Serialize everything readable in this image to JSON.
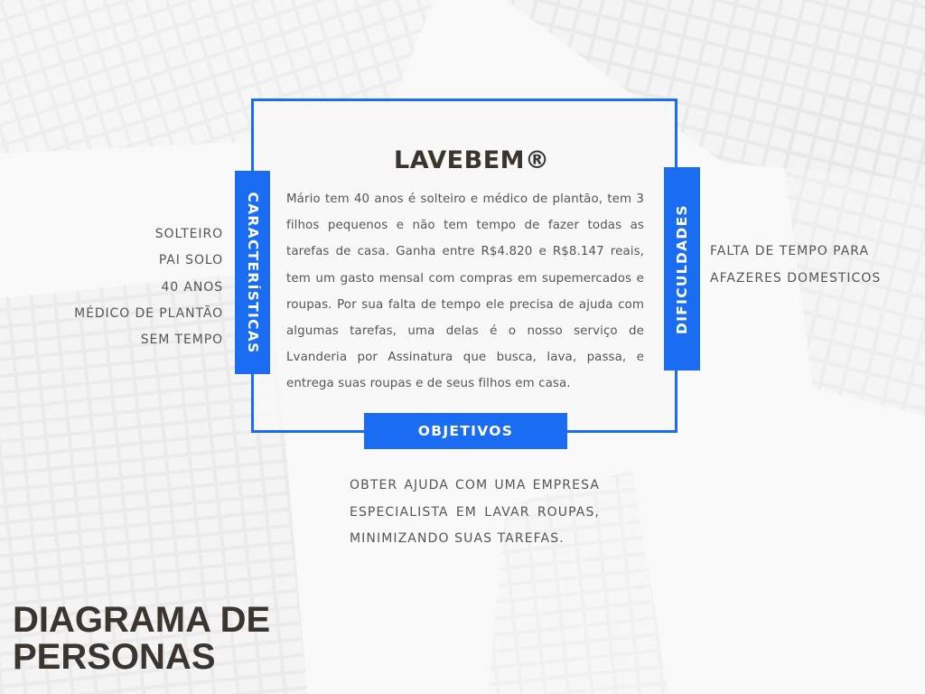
{
  "title": "LAVEBEM®",
  "description": "Mário tem 40 anos é solteiro e médico de plantão, tem 3 filhos pequenos e não tem tempo de fazer todas as tarefas de casa. Ganha entre R$4.820 e R$8.147 reais, tem um gasto mensal com compras em supemercados e roupas. Por sua falta de tempo ele precisa de ajuda com algumas tarefas, uma delas é o nosso serviço de Lvanderia por Assinatura que busca, lava, passa, e entrega suas roupas e de seus filhos em casa.",
  "tabs": {
    "characteristics": "CARACTERÍSTICAS",
    "difficulties": "DIFICULDADES",
    "objectives": "OBJETIVOS"
  },
  "characteristics": [
    "SOLTEIRO",
    "PAI SOLO",
    "40 ANOS",
    "MÉDICO DE PLANTÃO",
    "SEM TEMPO"
  ],
  "difficulties": "FALTA DE TEMPO PARA AFAZERES DOMESTICOS",
  "objectives": "OBTER AJUDA COM UMA EMPRESA ESPECIALISTA EM LAVAR ROUPAS, MINIMIZANDO SUAS TAREFAS.",
  "heading": "DIAGRAMA DE PERSONAS",
  "colors": {
    "accent": "#1a6cf2",
    "heading": "#3a352e",
    "text": "#555555"
  }
}
